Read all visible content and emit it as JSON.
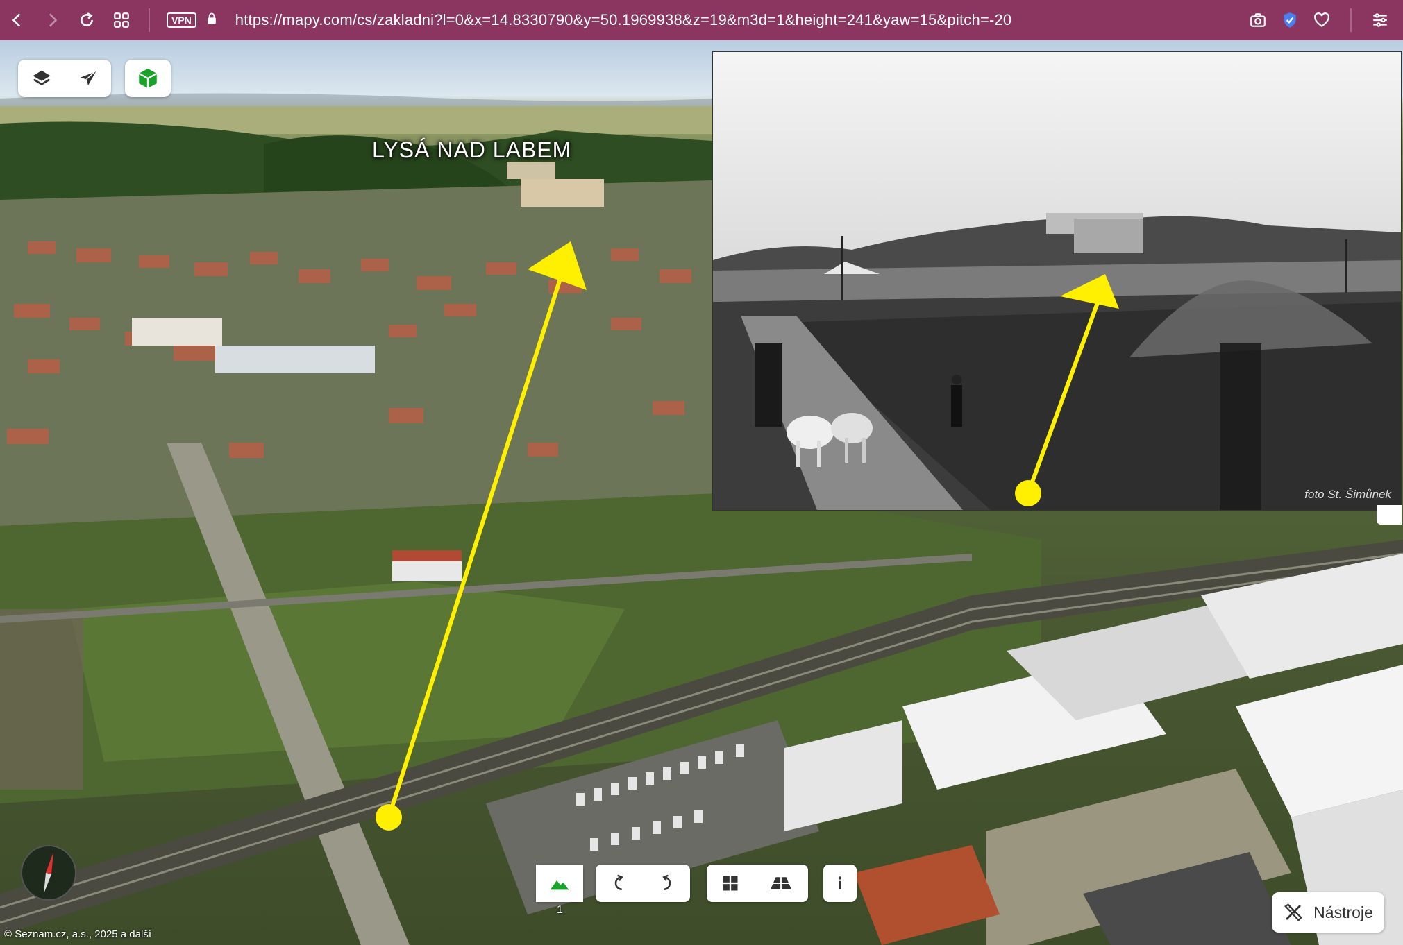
{
  "browser": {
    "url": "https://mapy.com/cs/zakladni?l=0&x=14.8330790&y=50.1969938&z=19&m3d=1&height=241&yaw=15&pitch=-20",
    "vpn_label": "VPN",
    "icons": [
      "back-icon",
      "forward-icon",
      "reload-icon",
      "tabs-grid-icon",
      "lock-icon",
      "camera-icon",
      "shield-icon",
      "heart-icon",
      "menu-icon"
    ]
  },
  "map": {
    "town_label": "LYSÁ NAD LABEM",
    "page_number": "1",
    "copyright": "© Seznam.cz, a.s., 2025 a další",
    "tools_label": "Nástroje",
    "photo_credit": "foto St. Šimůnek",
    "colors": {
      "arrow": "#ffef00",
      "toolbar_bg": "#8b3561",
      "active_green": "#1aa32a"
    }
  }
}
